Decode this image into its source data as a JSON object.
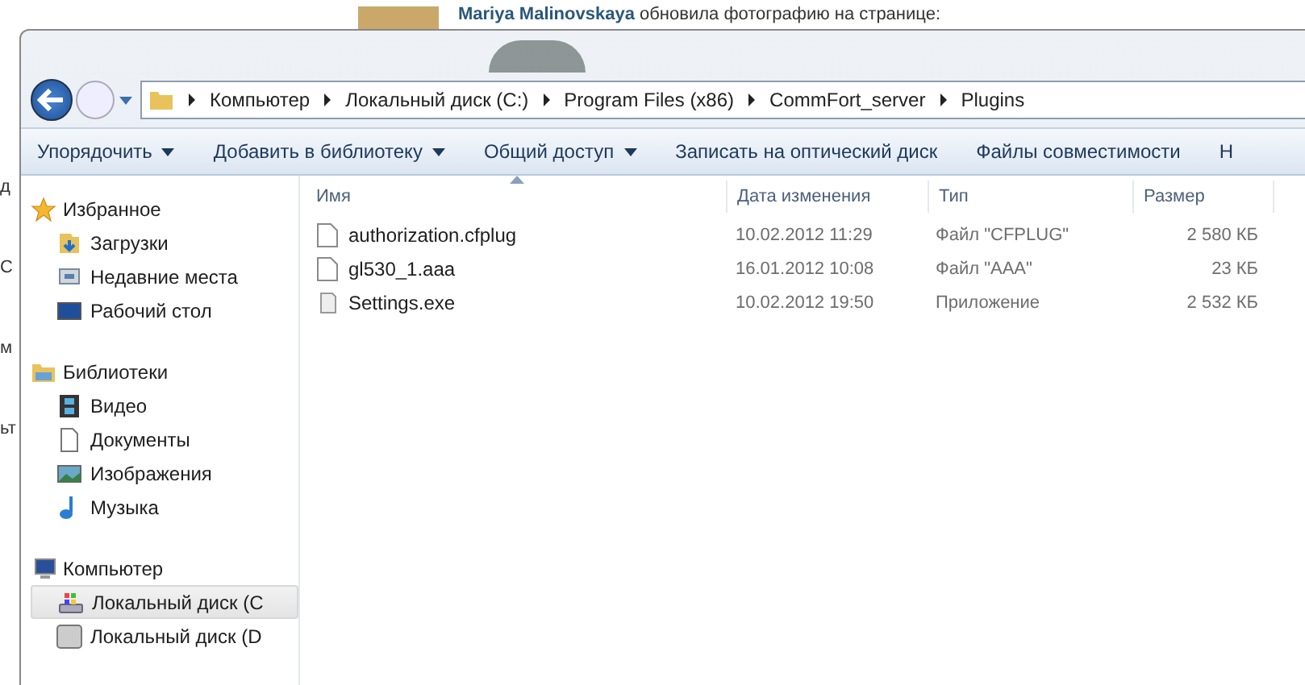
{
  "background_page": {
    "author": "Mariya Malinovskaya",
    "post_text": "обновила фотографию на странице:",
    "left_fragments": [
      "д",
      "С",
      "м",
      "ьт"
    ]
  },
  "address_bar": {
    "path": [
      "Компьютер",
      "Локальный диск (C:)",
      "Program Files (x86)",
      "CommFort_server",
      "Plugins"
    ]
  },
  "toolbar": [
    {
      "label": "Упорядочить",
      "dropdown": true
    },
    {
      "label": "Добавить в библиотеку",
      "dropdown": true
    },
    {
      "label": "Общий доступ",
      "dropdown": true
    },
    {
      "label": "Записать на оптический диск",
      "dropdown": false
    },
    {
      "label": "Файлы совместимости",
      "dropdown": false
    },
    {
      "label": "Н",
      "dropdown": false
    }
  ],
  "sidebar": {
    "groups": [
      {
        "label": "Избранное",
        "kind": "favorites",
        "items": [
          {
            "label": "Загрузки",
            "kind": "downloads",
            "selected": false
          },
          {
            "label": "Недавние места",
            "kind": "recent",
            "selected": false
          },
          {
            "label": "Рабочий стол",
            "kind": "desktop",
            "selected": false
          }
        ]
      },
      {
        "label": "Библиотеки",
        "kind": "libraries",
        "items": [
          {
            "label": "Видео",
            "kind": "video",
            "selected": false
          },
          {
            "label": "Документы",
            "kind": "documents",
            "selected": false
          },
          {
            "label": "Изображения",
            "kind": "pictures",
            "selected": false
          },
          {
            "label": "Музыка",
            "kind": "music",
            "selected": false
          }
        ]
      },
      {
        "label": "Компьютер",
        "kind": "computer",
        "items": [
          {
            "label": "Локальный диск (C",
            "kind": "system-drive",
            "selected": true
          },
          {
            "label": "Локальный диск (D",
            "kind": "drive",
            "selected": false
          }
        ]
      }
    ]
  },
  "table": {
    "columns": [
      "Имя",
      "Дата изменения",
      "Тип",
      "Размер"
    ],
    "rows": [
      {
        "kind": "file",
        "name": "authorization.cfplug",
        "date": "10.02.2012 11:29",
        "type": "Файл \"CFPLUG\"",
        "size": "2 580 КБ"
      },
      {
        "kind": "file",
        "name": "gl530_1.aaa",
        "date": "16.01.2012 10:08",
        "type": "Файл \"AAA\"",
        "size": "23 КБ"
      },
      {
        "kind": "exe",
        "name": "Settings.exe",
        "date": "10.02.2012 19:50",
        "type": "Приложение",
        "size": "2 532 КБ"
      }
    ]
  }
}
